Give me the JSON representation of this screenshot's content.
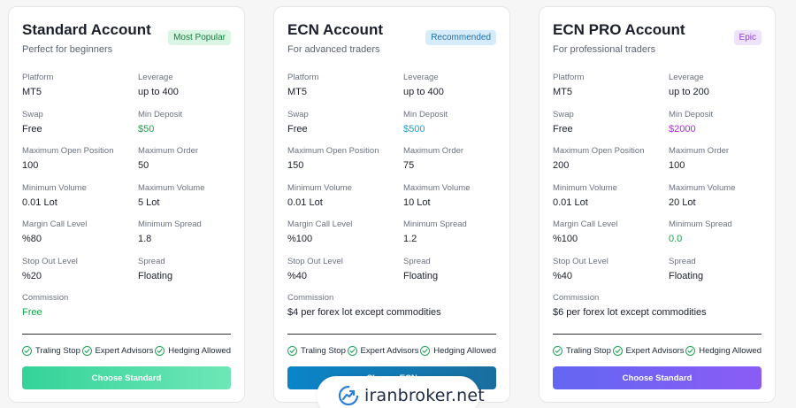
{
  "cards": [
    {
      "title": "Standard Account",
      "subtitle": "Perfect for beginners",
      "badge": "Most Popular",
      "badge_bg": "#d9f5e3",
      "badge_color": "#15803d",
      "specs": [
        {
          "label": "Platform",
          "value": "MT5"
        },
        {
          "label": "Leverage",
          "value": "up to 400"
        },
        {
          "label": "Swap",
          "value": "Free"
        },
        {
          "label": "Min Deposit",
          "value": "$50",
          "color": "#16a34a"
        },
        {
          "label": "Maximum Open Position",
          "value": "100"
        },
        {
          "label": "Maximum Order",
          "value": "50"
        },
        {
          "label": "Minimum Volume",
          "value": "0.01 Lot"
        },
        {
          "label": "Maximum Volume",
          "value": "5 Lot"
        },
        {
          "label": "Margin Call Level",
          "value": "%80"
        },
        {
          "label": "Minimum Spread",
          "value": "1.8"
        },
        {
          "label": "Stop Out Level",
          "value": "%20"
        },
        {
          "label": "Spread",
          "value": "Floating"
        },
        {
          "label": "Commission",
          "value": "Free",
          "color": "#16a34a",
          "full": true
        }
      ],
      "features": [
        "Traling Stop",
        "Expert Advisors",
        "Hedging Allowed"
      ],
      "button": "Choose Standard",
      "button_gradient": [
        "#34d399",
        "#6ee7b7"
      ]
    },
    {
      "title": "ECN Account",
      "subtitle": "For advanced traders",
      "badge": "Recommended",
      "badge_bg": "#d7ecfb",
      "badge_color": "#1e6fa8",
      "specs": [
        {
          "label": "Platform",
          "value": "MT5"
        },
        {
          "label": "Leverage",
          "value": "up to 400"
        },
        {
          "label": "Swap",
          "value": "Free"
        },
        {
          "label": "Min Deposit",
          "value": "$500",
          "color": "#0ea5d8"
        },
        {
          "label": "Maximum Open Position",
          "value": "150"
        },
        {
          "label": "Maximum Order",
          "value": "75"
        },
        {
          "label": "Minimum Volume",
          "value": "0.01 Lot"
        },
        {
          "label": "Maximum Volume",
          "value": "10 Lot"
        },
        {
          "label": "Margin Call Level",
          "value": "%100"
        },
        {
          "label": "Minimum Spread",
          "value": "1.2"
        },
        {
          "label": "Stop Out Level",
          "value": "%40"
        },
        {
          "label": "Spread",
          "value": "Floating"
        },
        {
          "label": "Commission",
          "value": "$4 per forex lot except commodities",
          "full": true
        }
      ],
      "features": [
        "Traling Stop",
        "Expert Advisors",
        "Hedging Allowed"
      ],
      "button": "Choose ECN",
      "button_gradient": [
        "#0a85c9",
        "#1a6e9e"
      ]
    },
    {
      "title": "ECN PRO Account",
      "subtitle": "For professional traders",
      "badge": "Epic",
      "badge_bg": "#efe3fb",
      "badge_color": "#8b3fd6",
      "specs": [
        {
          "label": "Platform",
          "value": "MT5"
        },
        {
          "label": "Leverage",
          "value": "up to 200"
        },
        {
          "label": "Swap",
          "value": "Free"
        },
        {
          "label": "Min Deposit",
          "value": "$2000",
          "color": "#b624e0"
        },
        {
          "label": "Maximum Open Position",
          "value": "200"
        },
        {
          "label": "Maximum Order",
          "value": "100"
        },
        {
          "label": "Minimum Volume",
          "value": "0.01 Lot"
        },
        {
          "label": "Maximum Volume",
          "value": "20 Lot"
        },
        {
          "label": "Margin Call Level",
          "value": "%100"
        },
        {
          "label": "Minimum Spread",
          "value": "0.0",
          "color": "#16a34a"
        },
        {
          "label": "Stop Out Level",
          "value": "%40"
        },
        {
          "label": "Spread",
          "value": "Floating"
        },
        {
          "label": "Commission",
          "value": "$6 per forex lot except commodities",
          "full": true
        }
      ],
      "features": [
        "Traling Stop",
        "Expert Advisors",
        "Hedging Allowed"
      ],
      "button": "Choose Standard",
      "button_gradient": [
        "#6366f1",
        "#8b5cf6"
      ]
    }
  ],
  "watermark": {
    "text": "iranbroker.net",
    "icon": "trend-arrow-logo-icon"
  },
  "colors": {
    "check": "#22a55a"
  }
}
